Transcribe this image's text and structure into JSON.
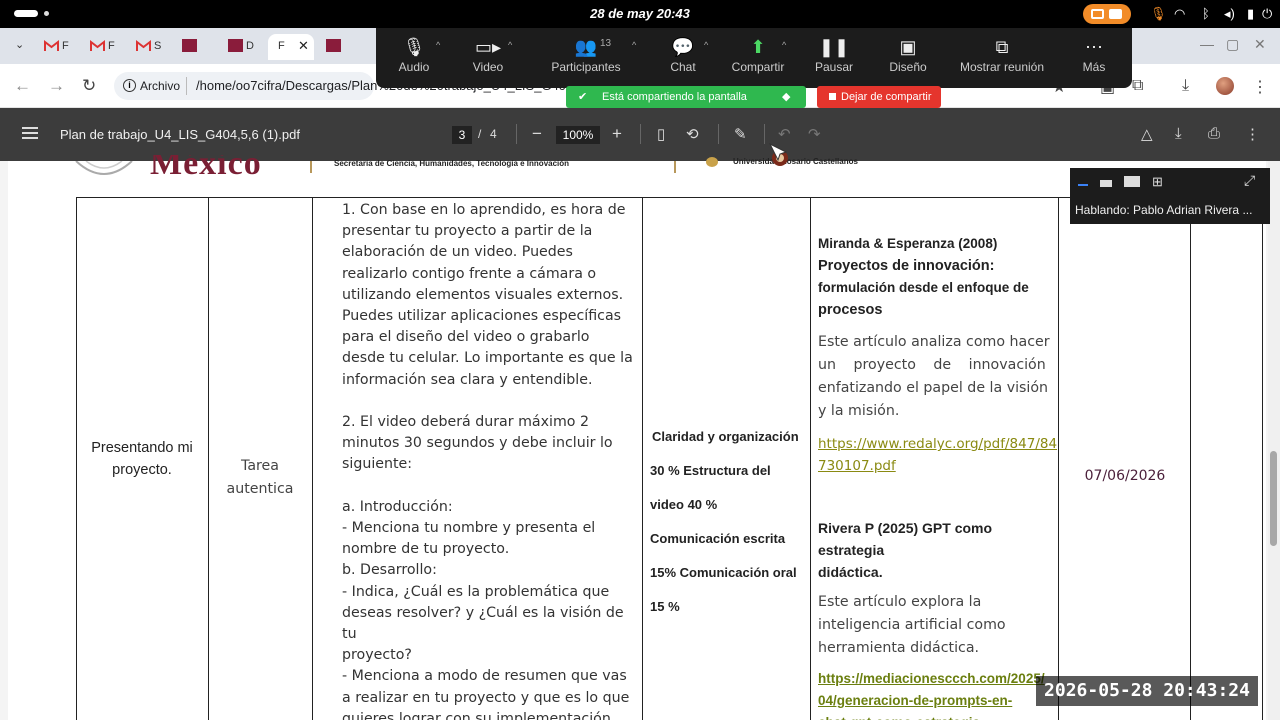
{
  "os": {
    "datetime": "28 de may  20:43",
    "icons": [
      "activities-pill",
      "screencast-icon",
      "mic-icon",
      "wifi-icon",
      "bluetooth-icon",
      "volume-icon",
      "battery-icon",
      "power-icon"
    ]
  },
  "browser": {
    "tabs": [
      {
        "icon": "gmail-icon",
        "title": "F"
      },
      {
        "icon": "gmail-icon",
        "title": "F"
      },
      {
        "icon": "gmail-icon",
        "title": "S"
      },
      {
        "icon": "unam-icon",
        "title": ""
      },
      {
        "icon": "unam-icon",
        "title": "D"
      },
      {
        "icon": "pdf-icon",
        "title": "F",
        "active": true
      },
      {
        "icon": "unam-icon",
        "title": ""
      }
    ],
    "site_label": "Archivo",
    "url": "/home/oo7cifra/Descargas/Plan%20de%20trabajo_U4_LIS_G4c"
  },
  "meet": {
    "buttons": [
      {
        "label": "Audio",
        "icon": "mic-icon"
      },
      {
        "label": "Video",
        "icon": "video-icon"
      },
      {
        "label": "Participantes",
        "icon": "participants-icon",
        "count": "13"
      },
      {
        "label": "Chat",
        "icon": "chat-icon"
      },
      {
        "label": "Compartir",
        "icon": "share-icon"
      },
      {
        "label": "Pausar",
        "icon": "pause-icon"
      },
      {
        "label": "Diseño",
        "icon": "layout-icon"
      },
      {
        "label": "Mostrar reunión",
        "icon": "show-meeting-icon"
      },
      {
        "label": "Más",
        "icon": "more-icon"
      }
    ],
    "sharing_label": "Está compartiendo la pantalla",
    "stop_label": "Dejar de compartir",
    "speaker": "Hablando: Pablo Adrian Rivera ..."
  },
  "pdf": {
    "title": "Plan de trabajo_U4_LIS_G404,5,6 (1).pdf",
    "current_page": "3",
    "separator": "/",
    "total_pages": "4",
    "zoom": "100%"
  },
  "document": {
    "header": {
      "logo_text": "México",
      "secretaria": "Secretaría de Ciencia, Humanidades, Tecnología e Innovación",
      "universidad": "Universidad Rosario Castellanos"
    },
    "row": {
      "activity": [
        "Presentando mi",
        "proyecto."
      ],
      "type": [
        "Tarea",
        "autentica"
      ],
      "instructions": [
        "1. Con base en lo aprendido, es hora de",
        "presentar tu proyecto a partir de la",
        "elaboración de un video. Puedes",
        "realizarlo contigo frente a cámara o",
        "utilizando elementos visuales externos.",
        "Puedes utilizar aplicaciones específicas",
        "para el diseño del video o grabarlo",
        "desde tu celular. Lo importante es que la",
        "información sea clara y entendible.",
        "",
        "2. El video deberá durar máximo 2",
        "minutos 30 segundos y debe incluir lo",
        "siguiente:",
        "",
        "a. Introducción:",
        "- Menciona tu nombre y presenta el",
        "nombre de tu proyecto.",
        "b. Desarrollo:",
        "- Indica, ¿Cuál es la problemática que",
        "deseas resolver? y ¿Cuál es la visión de tu",
        "proyecto?",
        "- Menciona a modo de resumen que vas",
        "a realizar en tu proyecto y que es lo que",
        "quieres lograr con su implementación."
      ],
      "criteria": [
        "Claridad y organización",
        "30 % Estructura del",
        "video 40 %",
        "Comunicación escrita",
        "15% Comunicación oral",
        "15 %"
      ],
      "ref1_heading": [
        "Miranda & Esperanza (2008)",
        "Proyectos de innovación:",
        "formulación desde el enfoque de",
        "procesos"
      ],
      "ref1_desc": [
        "Este artículo analiza como hacer",
        "un proyecto de innovación",
        "enfatizando el papel de la visión",
        "y la misión."
      ],
      "ref1_link": [
        "https://www.redalyc.org/pdf/847/84",
        "730107.pdf"
      ],
      "ref2_heading": [
        "Rivera P (2025) GPT como estrategia",
        "didáctica."
      ],
      "ref2_desc": [
        "Este artículo explora la",
        "inteligencia artificial como",
        "herramienta didáctica."
      ],
      "ref2_link": [
        "https://mediacionesccch.com/2025/",
        "04/generacion-de-prompts-en-",
        "chat-gpt-como-estrategia-"
      ],
      "date": "07/06/2026"
    }
  },
  "timestamp": "2026-05-28 20:43:24"
}
